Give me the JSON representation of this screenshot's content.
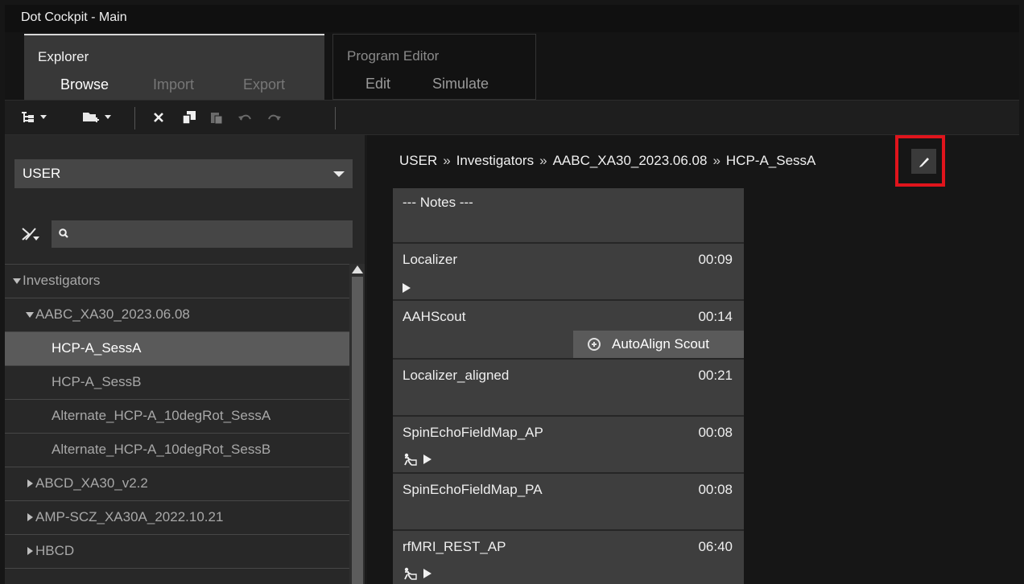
{
  "window": {
    "title": "Dot Cockpit - Main"
  },
  "ribbon": {
    "explorer": {
      "label": "Explorer",
      "tabs": [
        "Browse",
        "Import",
        "Export"
      ],
      "active": "Browse"
    },
    "program_editor": {
      "label": "Program Editor",
      "tabs": [
        "Edit",
        "Simulate"
      ]
    }
  },
  "toolbar": {
    "buttons": [
      {
        "icon": "tree-view-icon",
        "dropdown": true
      },
      {
        "icon": "new-folder-icon",
        "dropdown": true
      },
      {
        "icon": "delete-icon"
      },
      {
        "icon": "copy-icon"
      },
      {
        "icon": "paste-icon"
      },
      {
        "icon": "undo-icon"
      },
      {
        "icon": "redo-icon"
      }
    ]
  },
  "sidebar": {
    "scope": "USER",
    "search": {
      "value": "",
      "placeholder": ""
    },
    "tree": [
      {
        "label": "Investigators",
        "level": 0,
        "expanded": true
      },
      {
        "label": "AABC_XA30_2023.06.08",
        "level": 1,
        "expanded": true
      },
      {
        "label": "HCP-A_SessA",
        "level": 2,
        "selected": true
      },
      {
        "label": "HCP-A_SessB",
        "level": 2
      },
      {
        "label": "Alternate_HCP-A_10degRot_SessA",
        "level": 2
      },
      {
        "label": "Alternate_HCP-A_10degRot_SessB",
        "level": 2
      },
      {
        "label": "ABCD_XA30_v2.2",
        "level": 1,
        "expanded": false
      },
      {
        "label": "AMP-SCZ_XA30A_2022.10.21",
        "level": 1,
        "expanded": false
      },
      {
        "label": "HBCD",
        "level": 1,
        "expanded": false
      }
    ]
  },
  "main": {
    "breadcrumb": [
      "USER",
      "Investigators",
      "AABC_XA30_2023.06.08",
      "HCP-A_SessA"
    ],
    "breadcrumb_separator": "»",
    "edit_button_icon": "pencil-icon",
    "highlight_color": "#e0141c",
    "steps": [
      {
        "name": "--- Notes ---",
        "time": "",
        "icons": []
      },
      {
        "name": "Localizer",
        "time": "00:09",
        "icons": [
          "play-icon"
        ]
      },
      {
        "name": "AAHScout",
        "time": "00:14",
        "icons": [],
        "action": "AutoAlign Scout"
      },
      {
        "name": "Localizer_aligned",
        "time": "00:21",
        "icons": []
      },
      {
        "name": "SpinEchoFieldMap_AP",
        "time": "00:08",
        "icons": [
          "person-icon",
          "play-icon"
        ]
      },
      {
        "name": "SpinEchoFieldMap_PA",
        "time": "00:08",
        "icons": []
      },
      {
        "name": "rfMRI_REST_AP",
        "time": "06:40",
        "icons": [
          "person-icon",
          "play-icon"
        ]
      }
    ]
  }
}
